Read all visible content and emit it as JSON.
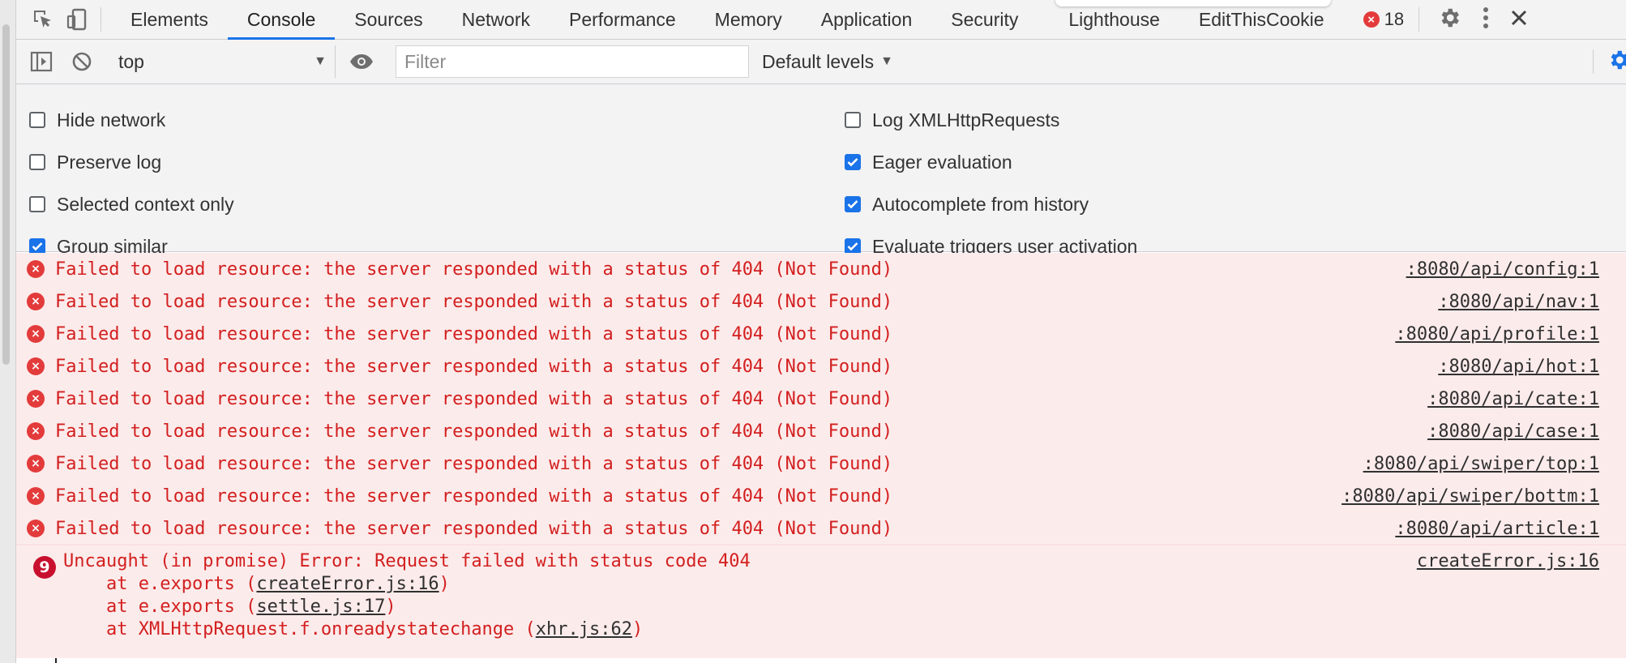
{
  "tabs": [
    {
      "label": "Elements",
      "active": false
    },
    {
      "label": "Console",
      "active": true
    },
    {
      "label": "Sources",
      "active": false
    },
    {
      "label": "Network",
      "active": false
    },
    {
      "label": "Performance",
      "active": false
    },
    {
      "label": "Memory",
      "active": false
    },
    {
      "label": "Application",
      "active": false
    },
    {
      "label": "Security",
      "active": false
    },
    {
      "label": "Lighthouse",
      "active": false
    },
    {
      "label": "EditThisCookie",
      "active": false
    }
  ],
  "error_count": "18",
  "toolbar": {
    "context": "top",
    "filter_placeholder": "Filter",
    "levels": "Default levels"
  },
  "settings": {
    "left": [
      {
        "label": "Hide network",
        "checked": false
      },
      {
        "label": "Preserve log",
        "checked": false
      },
      {
        "label": "Selected context only",
        "checked": false
      },
      {
        "label": "Group similar",
        "checked": true
      }
    ],
    "right": [
      {
        "label": "Log XMLHttpRequests",
        "checked": false
      },
      {
        "label": "Eager evaluation",
        "checked": true
      },
      {
        "label": "Autocomplete from history",
        "checked": true
      },
      {
        "label": "Evaluate triggers user activation",
        "checked": true
      }
    ]
  },
  "messages": [
    {
      "text": "Failed to load resource: the server responded with a status of 404 (Not Found)",
      "source": ":8080/api/config:1"
    },
    {
      "text": "Failed to load resource: the server responded with a status of 404 (Not Found)",
      "source": ":8080/api/nav:1"
    },
    {
      "text": "Failed to load resource: the server responded with a status of 404 (Not Found)",
      "source": ":8080/api/profile:1"
    },
    {
      "text": "Failed to load resource: the server responded with a status of 404 (Not Found)",
      "source": ":8080/api/hot:1"
    },
    {
      "text": "Failed to load resource: the server responded with a status of 404 (Not Found)",
      "source": ":8080/api/cate:1"
    },
    {
      "text": "Failed to load resource: the server responded with a status of 404 (Not Found)",
      "source": ":8080/api/case:1"
    },
    {
      "text": "Failed to load resource: the server responded with a status of 404 (Not Found)",
      "source": ":8080/api/swiper/top:1"
    },
    {
      "text": "Failed to load resource: the server responded with a status of 404 (Not Found)",
      "source": ":8080/api/swiper/bottm:1"
    },
    {
      "text": "Failed to load resource: the server responded with a status of 404 (Not Found)",
      "source": ":8080/api/article:1"
    }
  ],
  "uncaught": {
    "count": "9",
    "text": "Uncaught (in promise) Error: Request failed with status code 404",
    "source": "createError.js:16",
    "stack": [
      {
        "prefix": "    at e.exports (",
        "link": "createError.js:16",
        "suffix": ")"
      },
      {
        "prefix": "    at e.exports (",
        "link": "settle.js:17",
        "suffix": ")"
      },
      {
        "prefix": "    at XMLHttpRequest.f.onreadystatechange (",
        "link": "xhr.js:62",
        "suffix": ")"
      }
    ]
  },
  "prompt_symbol": "›"
}
